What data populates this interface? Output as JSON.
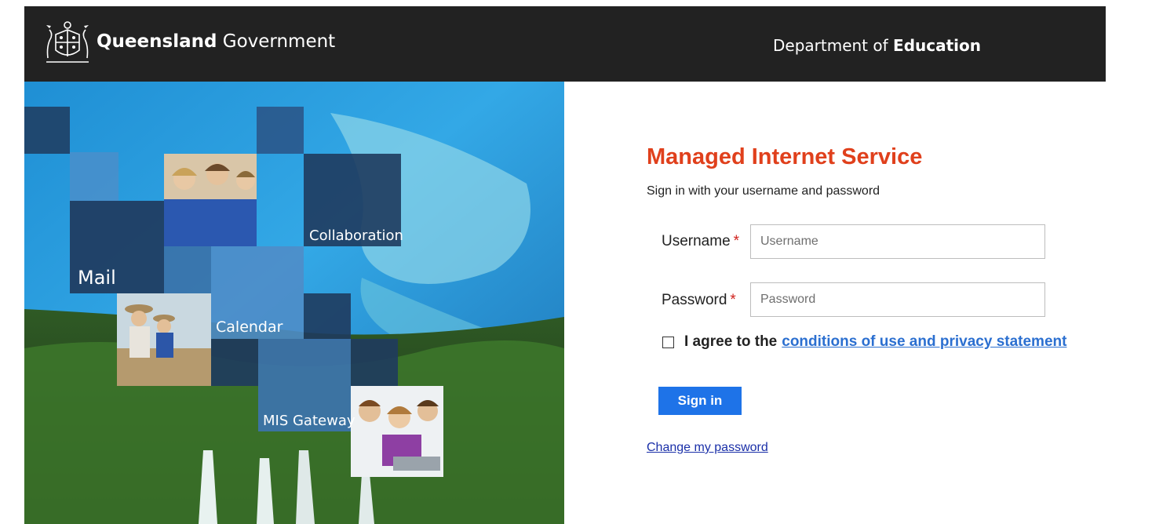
{
  "header": {
    "brand_strong": "Queensland",
    "brand_light": "Government",
    "dept_prefix": "Department of",
    "dept_strong": "Education",
    "colors": {
      "bar": "#222222",
      "text": "#ffffff"
    }
  },
  "hero": {
    "tiles": {
      "mail": "Mail",
      "collaboration": "Collaboration",
      "calendar": "Calendar",
      "mis_gateway": "MIS Gateway"
    }
  },
  "login": {
    "title": "Managed Internet Service",
    "subtitle": "Sign in with your username and password",
    "username_label": "Username",
    "username_placeholder": "Username",
    "username_value": "",
    "password_label": "Password",
    "password_placeholder": "Password",
    "password_value": "",
    "required_mark": "*",
    "agree_text": "I agree to the",
    "agree_link": "conditions of use and privacy statement",
    "agree_checked": false,
    "signin_label": "Sign in",
    "change_password": "Change my password",
    "colors": {
      "title": "#e0401c",
      "button": "#1e73e8",
      "link": "#2b6fd0",
      "required": "#d0211c"
    }
  }
}
